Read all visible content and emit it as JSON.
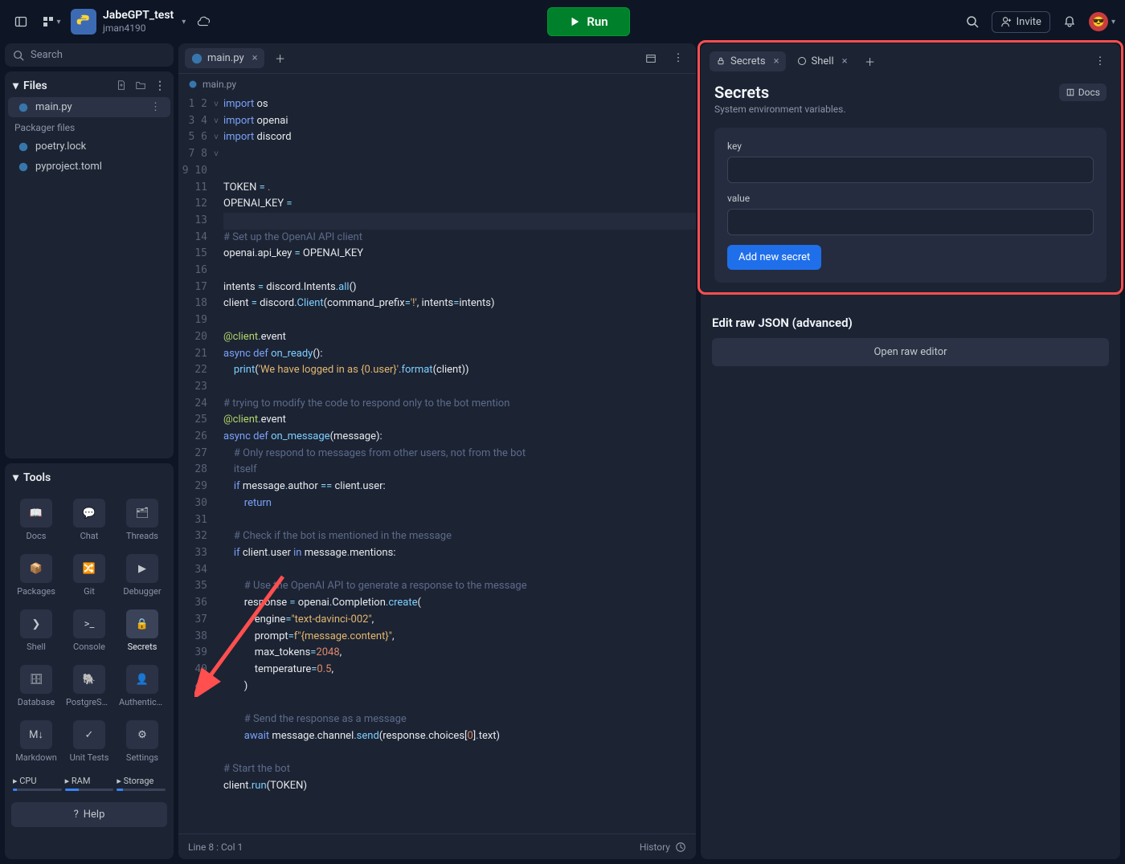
{
  "header": {
    "project_title": "JabeGPT_test",
    "project_owner": "jman4190",
    "run_label": "Run",
    "invite_label": "Invite"
  },
  "search": {
    "placeholder": "Search"
  },
  "files": {
    "header": "Files",
    "items": [
      "main.py"
    ],
    "packager_label": "Packager files",
    "packager_items": [
      "poetry.lock",
      "pyproject.toml"
    ]
  },
  "tools": {
    "header": "Tools",
    "items": [
      {
        "label": "Docs",
        "icon": "book"
      },
      {
        "label": "Chat",
        "icon": "chat"
      },
      {
        "label": "Threads",
        "icon": "threads"
      },
      {
        "label": "Packages",
        "icon": "cube"
      },
      {
        "label": "Git",
        "icon": "git"
      },
      {
        "label": "Debugger",
        "icon": "play"
      },
      {
        "label": "Shell",
        "icon": "shell"
      },
      {
        "label": "Console",
        "icon": "console"
      },
      {
        "label": "Secrets",
        "icon": "lock",
        "active": true
      },
      {
        "label": "Database",
        "icon": "db"
      },
      {
        "label": "PostgreSQL",
        "icon": "pg"
      },
      {
        "label": "Authentication",
        "icon": "auth"
      },
      {
        "label": "Markdown",
        "icon": "md"
      },
      {
        "label": "Unit Tests",
        "icon": "check"
      },
      {
        "label": "Settings",
        "icon": "gear"
      }
    ],
    "resources": [
      {
        "label": "CPU",
        "pct": 8
      },
      {
        "label": "RAM",
        "pct": 28
      },
      {
        "label": "Storage",
        "pct": 12
      }
    ],
    "help_label": "Help"
  },
  "editor": {
    "tab_label": "main.py",
    "breadcrumb": "main.py",
    "status_left": "Line 8 : Col 1",
    "history_label": "History",
    "line_count": 41,
    "fold_markers": {
      "16": "v",
      "21": "v",
      "23": "v",
      "27": "v"
    },
    "highlighted_line": 8,
    "code_lines": [
      [
        [
          "kw",
          "import"
        ],
        [
          "sp",
          " "
        ],
        [
          "self",
          "os"
        ]
      ],
      [
        [
          "kw",
          "import"
        ],
        [
          "sp",
          " "
        ],
        [
          "self",
          "openai"
        ]
      ],
      [
        [
          "kw",
          "import"
        ],
        [
          "sp",
          " "
        ],
        [
          "self",
          "discord"
        ]
      ],
      [],
      [],
      [
        [
          "self",
          "TOKEN "
        ],
        [
          "op",
          "="
        ],
        [
          "sp",
          " "
        ],
        [
          "err",
          "."
        ]
      ],
      [
        [
          "self",
          "OPENAI_KEY "
        ],
        [
          "op",
          "="
        ],
        [
          "sp",
          " "
        ]
      ],
      [],
      [
        [
          "cm",
          "# Set up the OpenAI API client"
        ]
      ],
      [
        [
          "self",
          "openai"
        ],
        [
          "op",
          "."
        ],
        [
          "self",
          "api_key "
        ],
        [
          "op",
          "="
        ],
        [
          "sp",
          " "
        ],
        [
          "self",
          "OPENAI_KEY"
        ]
      ],
      [],
      [
        [
          "self",
          "intents "
        ],
        [
          "op",
          "="
        ],
        [
          "sp",
          " "
        ],
        [
          "self",
          "discord"
        ],
        [
          "op",
          "."
        ],
        [
          "self",
          "Intents"
        ],
        [
          "op",
          "."
        ],
        [
          "fn",
          "all"
        ],
        [
          "self",
          "()"
        ]
      ],
      [
        [
          "self",
          "client "
        ],
        [
          "op",
          "="
        ],
        [
          "sp",
          " "
        ],
        [
          "self",
          "discord"
        ],
        [
          "op",
          "."
        ],
        [
          "fn",
          "Client"
        ],
        [
          "self",
          "("
        ],
        [
          "self",
          "command_prefix"
        ],
        [
          "op",
          "="
        ],
        [
          "str",
          "'!'"
        ],
        [
          "self",
          ", intents"
        ],
        [
          "op",
          "="
        ],
        [
          "self",
          "intents)"
        ]
      ],
      [],
      [
        [
          "dec",
          "@client"
        ],
        [
          "op",
          "."
        ],
        [
          "self",
          "event"
        ]
      ],
      [
        [
          "kw",
          "async"
        ],
        [
          "sp",
          " "
        ],
        [
          "kw",
          "def"
        ],
        [
          "sp",
          " "
        ],
        [
          "fn",
          "on_ready"
        ],
        [
          "self",
          "():"
        ]
      ],
      [
        [
          "sp",
          "    "
        ],
        [
          "fn",
          "print"
        ],
        [
          "self",
          "("
        ],
        [
          "str",
          "'We have logged in as {0.user}'"
        ],
        [
          "op",
          "."
        ],
        [
          "fn",
          "format"
        ],
        [
          "self",
          "(client))"
        ]
      ],
      [],
      [
        [
          "cm",
          "# trying to modify the code to respond only to the bot mention"
        ]
      ],
      [
        [
          "dec",
          "@client"
        ],
        [
          "op",
          "."
        ],
        [
          "self",
          "event"
        ]
      ],
      [
        [
          "kw",
          "async"
        ],
        [
          "sp",
          " "
        ],
        [
          "kw",
          "def"
        ],
        [
          "sp",
          " "
        ],
        [
          "fn",
          "on_message"
        ],
        [
          "self",
          "(message):"
        ]
      ],
      [
        [
          "sp",
          "    "
        ],
        [
          "cm",
          "# Only respond to messages from other users, not from the bot\n    itself"
        ]
      ],
      [
        [
          "sp",
          "    "
        ],
        [
          "kw",
          "if"
        ],
        [
          "sp",
          " "
        ],
        [
          "self",
          "message"
        ],
        [
          "op",
          "."
        ],
        [
          "self",
          "author "
        ],
        [
          "op",
          "=="
        ],
        [
          "sp",
          " "
        ],
        [
          "self",
          "client"
        ],
        [
          "op",
          "."
        ],
        [
          "self",
          "user:"
        ]
      ],
      [
        [
          "sp",
          "        "
        ],
        [
          "kw",
          "return"
        ]
      ],
      [],
      [
        [
          "sp",
          "    "
        ],
        [
          "cm",
          "# Check if the bot is mentioned in the message"
        ]
      ],
      [
        [
          "sp",
          "    "
        ],
        [
          "kw",
          "if"
        ],
        [
          "sp",
          " "
        ],
        [
          "self",
          "client"
        ],
        [
          "op",
          "."
        ],
        [
          "self",
          "user "
        ],
        [
          "kw",
          "in"
        ],
        [
          "sp",
          " "
        ],
        [
          "self",
          "message"
        ],
        [
          "op",
          "."
        ],
        [
          "self",
          "mentions:"
        ]
      ],
      [],
      [
        [
          "sp",
          "        "
        ],
        [
          "cm",
          "# Use the OpenAI API to generate a response to the message"
        ]
      ],
      [
        [
          "sp",
          "        "
        ],
        [
          "self",
          "response "
        ],
        [
          "op",
          "="
        ],
        [
          "sp",
          " "
        ],
        [
          "self",
          "openai"
        ],
        [
          "op",
          "."
        ],
        [
          "self",
          "Completion"
        ],
        [
          "op",
          "."
        ],
        [
          "fn",
          "create"
        ],
        [
          "self",
          "("
        ]
      ],
      [
        [
          "sp",
          "            "
        ],
        [
          "self",
          "engine"
        ],
        [
          "op",
          "="
        ],
        [
          "str",
          "\"text-davinci-002\""
        ],
        [
          "self",
          ","
        ]
      ],
      [
        [
          "sp",
          "            "
        ],
        [
          "self",
          "prompt"
        ],
        [
          "op",
          "="
        ],
        [
          "str",
          "f\"{message.content}\""
        ],
        [
          "self",
          ","
        ]
      ],
      [
        [
          "sp",
          "            "
        ],
        [
          "self",
          "max_tokens"
        ],
        [
          "op",
          "="
        ],
        [
          "num",
          "2048"
        ],
        [
          "self",
          ","
        ]
      ],
      [
        [
          "sp",
          "            "
        ],
        [
          "self",
          "temperature"
        ],
        [
          "op",
          "="
        ],
        [
          "num",
          "0.5"
        ],
        [
          "self",
          ","
        ]
      ],
      [
        [
          "sp",
          "        "
        ],
        [
          "self",
          ")"
        ]
      ],
      [],
      [
        [
          "sp",
          "        "
        ],
        [
          "cm",
          "# Send the response as a message"
        ]
      ],
      [
        [
          "sp",
          "        "
        ],
        [
          "kw",
          "await"
        ],
        [
          "sp",
          " "
        ],
        [
          "self",
          "message"
        ],
        [
          "op",
          "."
        ],
        [
          "self",
          "channel"
        ],
        [
          "op",
          "."
        ],
        [
          "fn",
          "send"
        ],
        [
          "self",
          "(response"
        ],
        [
          "op",
          "."
        ],
        [
          "self",
          "choices["
        ],
        [
          "num",
          "0"
        ],
        [
          "self",
          "]"
        ],
        [
          "op",
          "."
        ],
        [
          "self",
          "text)"
        ]
      ],
      [],
      [
        [
          "cm",
          "# Start the bot"
        ]
      ],
      [
        [
          "self",
          "client"
        ],
        [
          "op",
          "."
        ],
        [
          "fn",
          "run"
        ],
        [
          "self",
          "(TOKEN)"
        ]
      ]
    ]
  },
  "secrets": {
    "tab_secrets": "Secrets",
    "tab_shell": "Shell",
    "title": "Secrets",
    "subtitle": "System environment variables.",
    "docs_label": "Docs",
    "key_label": "key",
    "value_label": "value",
    "add_label": "Add new secret",
    "advanced_label": "Edit raw JSON (advanced)",
    "raw_editor_label": "Open raw editor"
  }
}
